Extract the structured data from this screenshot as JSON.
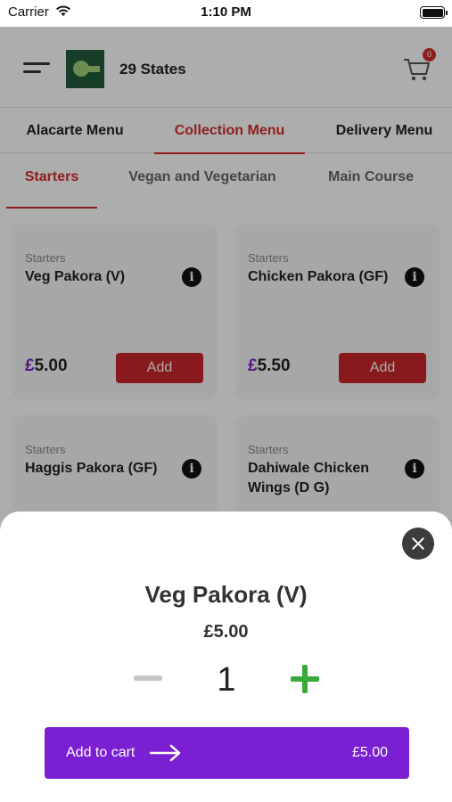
{
  "status_bar": {
    "carrier": "Carrier",
    "time": "1:10 PM"
  },
  "header": {
    "store_name": "29 States",
    "cart_count": "0"
  },
  "menu_tabs": [
    {
      "label": "Alacarte Menu",
      "active": false
    },
    {
      "label": "Collection Menu",
      "active": true
    },
    {
      "label": "Delivery Menu",
      "active": false
    }
  ],
  "category_tabs": [
    {
      "label": "Starters",
      "active": true
    },
    {
      "label": "Vegan and Vegetarian",
      "active": false
    },
    {
      "label": "Main Course",
      "active": false
    }
  ],
  "items": [
    {
      "category": "Starters",
      "name": "Veg Pakora (V)",
      "currency": "£",
      "price": "5.00",
      "add_label": "Add"
    },
    {
      "category": "Starters",
      "name": "Chicken Pakora (GF)",
      "currency": "£",
      "price": "5.50",
      "add_label": "Add"
    },
    {
      "category": "Starters",
      "name": "Haggis Pakora (GF)"
    },
    {
      "category": "Starters",
      "name": "Dahiwale Chicken Wings (D G)"
    }
  ],
  "sheet": {
    "title": "Veg Pakora (V)",
    "price": "£5.00",
    "quantity": "1",
    "add_to_cart_label": "Add to cart",
    "total": "£5.00"
  },
  "colors": {
    "accent": "#d32f2f",
    "purple": "#7a1fd1",
    "green": "#3aa83a"
  }
}
